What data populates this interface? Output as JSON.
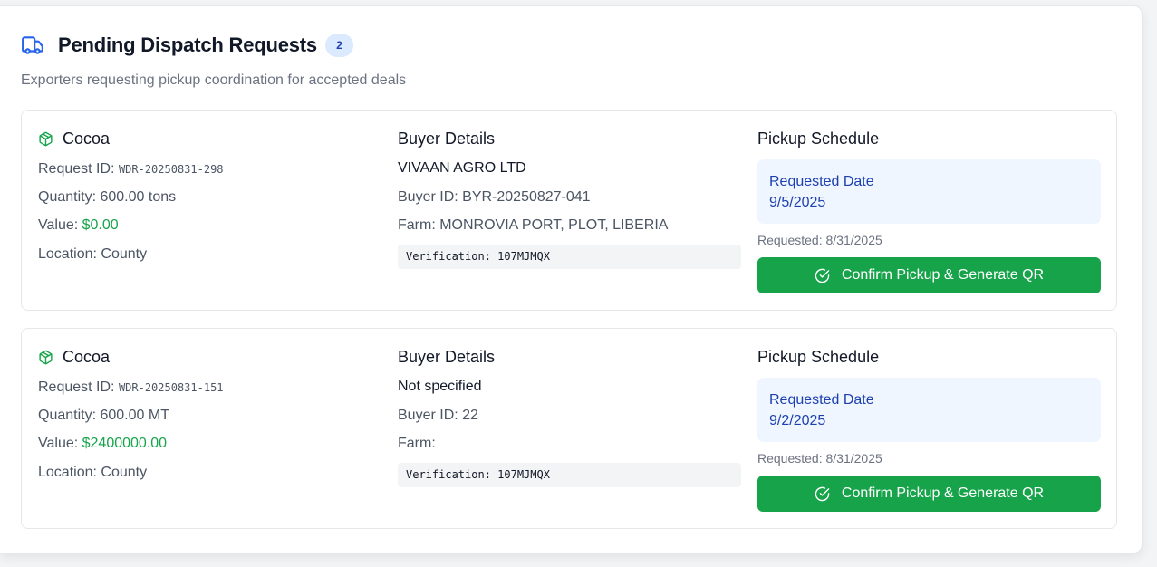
{
  "header": {
    "title": "Pending Dispatch Requests",
    "count": "2",
    "subtitle": "Exporters requesting pickup coordination for accepted deals"
  },
  "labels": {
    "request_id": "Request ID: ",
    "quantity": "Quantity: ",
    "value": "Value: ",
    "location": "Location: ",
    "buyer_details": "Buyer Details",
    "buyer_id": "Buyer ID: ",
    "farm": "Farm: ",
    "verification": "Verification: ",
    "pickup_schedule": "Pickup Schedule",
    "requested_date": "Requested Date",
    "requested": "Requested: ",
    "confirm_button": "Confirm Pickup & Generate QR"
  },
  "requests": [
    {
      "product": "Cocoa",
      "request_id": "WDR-20250831-298",
      "quantity": "600.00 tons",
      "value": "$0.00",
      "location": "County",
      "buyer_name": "VIVAAN AGRO LTD",
      "buyer_id": "BYR-20250827-041",
      "farm": "MONROVIA PORT, PLOT, LIBERIA",
      "verification": "107MJMQX",
      "requested_date": "9/5/2025",
      "requested_on": "8/31/2025"
    },
    {
      "product": "Cocoa",
      "request_id": "WDR-20250831-151",
      "quantity": "600.00 MT",
      "value": "$2400000.00",
      "location": "County",
      "buyer_name": "Not specified",
      "buyer_id": "22",
      "farm": "",
      "verification": "107MJMQX",
      "requested_date": "9/2/2025",
      "requested_on": "8/31/2025"
    }
  ],
  "icons": {
    "header": "truck-icon",
    "product": "package-icon",
    "button": "check-circle-icon"
  },
  "colors": {
    "accent_blue": "#2563eb",
    "green": "#16a34a",
    "badge_bg": "#dbeafe",
    "schedule_bg": "#eff6ff"
  }
}
